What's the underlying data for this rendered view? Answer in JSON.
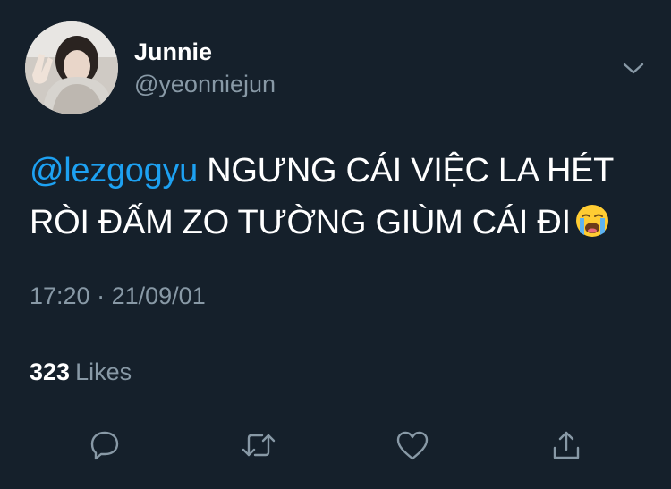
{
  "user": {
    "display_name": "Junnie",
    "handle": "@yeonniejun"
  },
  "tweet": {
    "mention": "@lezgogyu",
    "line1_rest": "NGƯNG CÁI VIỆC LA HÉT",
    "line2": "RÒI ĐẤM ZO TƯỜNG GIÙM CÁI ĐI",
    "emoji": "loudly-crying-face"
  },
  "meta": {
    "time": "17:20",
    "separator": "·",
    "date": "21/09/01"
  },
  "stats": {
    "likes_count": "323",
    "likes_label": "Likes"
  },
  "actions": [
    "reply-icon",
    "retweet-icon",
    "like-icon",
    "share-icon"
  ],
  "colors": {
    "background": "#15202b",
    "mention": "#1da1f2",
    "secondary_text": "#8899a6",
    "divider": "#38444d"
  }
}
